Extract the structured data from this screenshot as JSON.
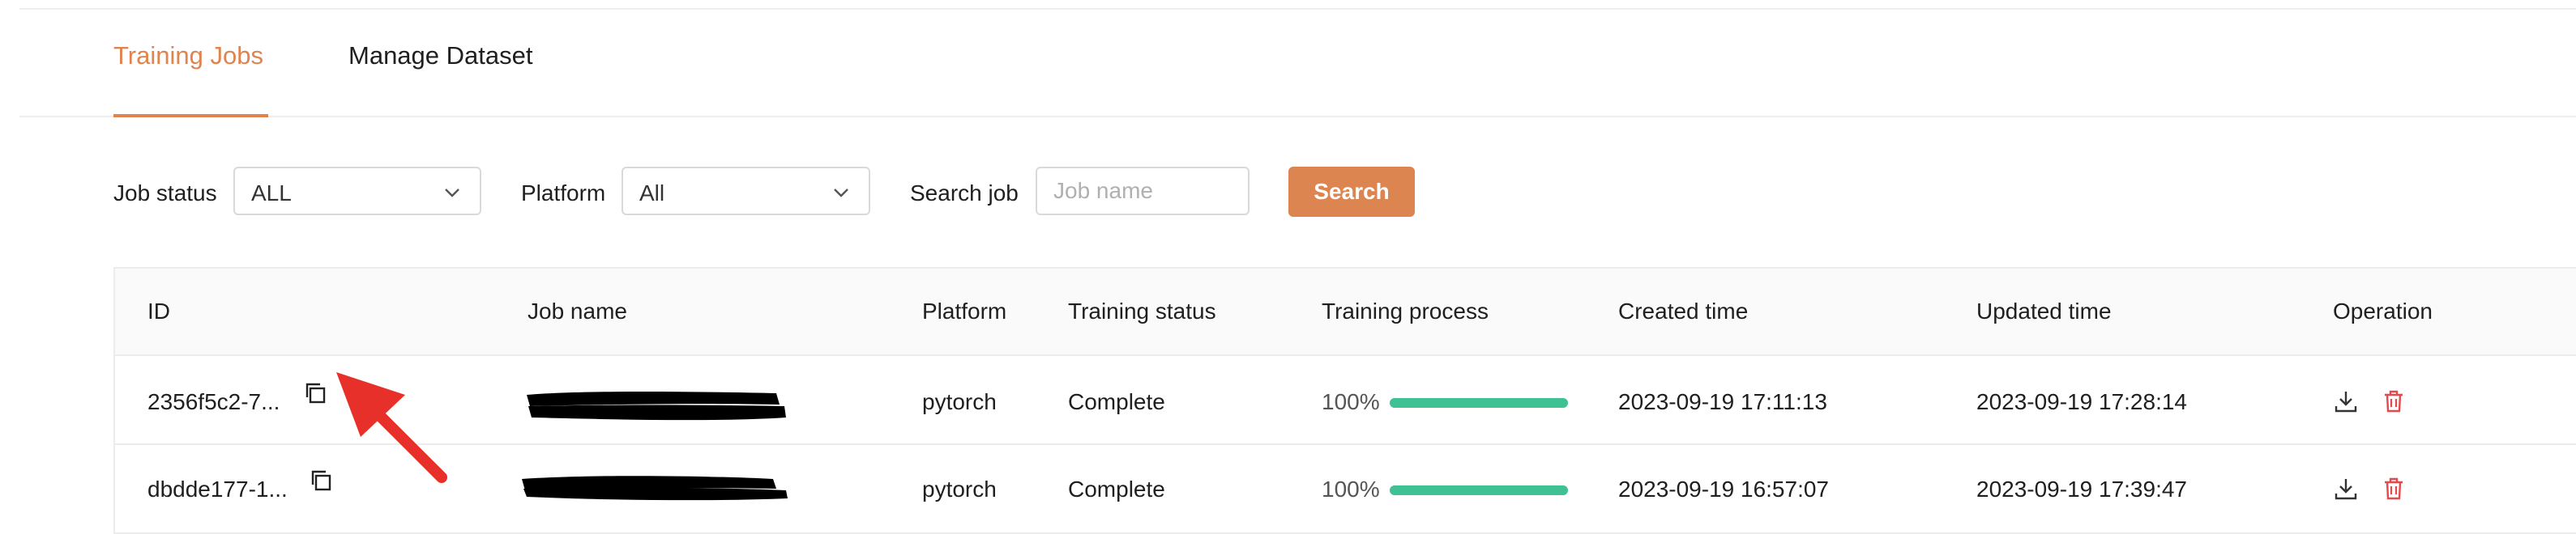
{
  "tabs": [
    {
      "label": "Training Jobs",
      "active": true
    },
    {
      "label": "Manage Dataset",
      "active": false
    }
  ],
  "filters": {
    "job_status_label": "Job status",
    "job_status_value": "ALL",
    "platform_label": "Platform",
    "platform_value": "All",
    "search_label": "Search job",
    "search_placeholder": "Job name",
    "search_value": "",
    "search_button": "Search"
  },
  "table": {
    "columns": [
      "ID",
      "Job name",
      "Platform",
      "Training status",
      "Training process",
      "Created time",
      "Updated time",
      "Operation"
    ],
    "rows": [
      {
        "id": "2356f5c2-7...",
        "job_name": "",
        "platform": "pytorch",
        "status": "Complete",
        "progress_text": "100%",
        "progress": 1.0,
        "created": "2023-09-19 17:11:13",
        "updated": "2023-09-19 17:28:14"
      },
      {
        "id": "dbdde177-1...",
        "job_name": "",
        "platform": "pytorch",
        "status": "Complete",
        "progress_text": "100%",
        "progress": 1.0,
        "created": "2023-09-19 16:57:07",
        "updated": "2023-09-19 17:39:47"
      }
    ]
  },
  "icons": {
    "copy": "copy-icon",
    "download": "download-icon",
    "delete": "trash-icon",
    "dropdown": "chevron-down-icon"
  },
  "colors": {
    "accent": "#e0834e",
    "progress": "#3fc193",
    "delete": "#e5484d",
    "annotation_arrow": "#e8302a"
  }
}
